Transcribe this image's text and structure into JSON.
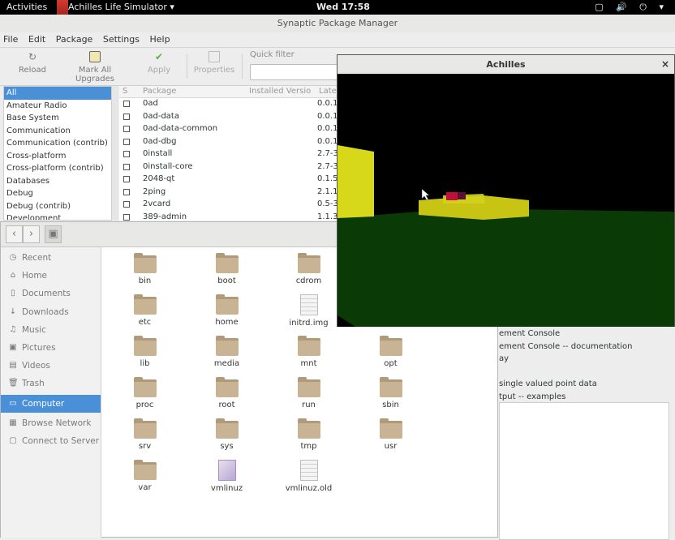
{
  "topbar": {
    "activities": "Activities",
    "app_menu": "Achilles Life Simulator ▾",
    "clock": "Wed 17:58",
    "tray": "▢ 🔊 ⏻ ▾"
  },
  "synaptic": {
    "title": "Synaptic Package Manager",
    "menu": [
      "File",
      "Edit",
      "Package",
      "Settings",
      "Help"
    ],
    "toolbar": {
      "reload": "Reload",
      "mark_all": "Mark All Upgrades",
      "apply": "Apply",
      "properties": "Properties",
      "quick_filter": "Quick filter"
    },
    "categories": [
      "All",
      "Amateur Radio",
      "Base System",
      "Communication",
      "Communication (contrib)",
      "Cross-platform",
      "Cross-platform (contrib)",
      "Databases",
      "Debug",
      "Debug (contrib)",
      "Development"
    ],
    "columns": {
      "s": "S",
      "package": "Package",
      "installed": "Installed Versio",
      "latest": "Late"
    },
    "packages": [
      {
        "name": "0ad",
        "ver": "0.0.1"
      },
      {
        "name": "0ad-data",
        "ver": "0.0.1"
      },
      {
        "name": "0ad-data-common",
        "ver": "0.0.1"
      },
      {
        "name": "0ad-dbg",
        "ver": "0.0.1"
      },
      {
        "name": "0install",
        "ver": "2.7-3"
      },
      {
        "name": "0install-core",
        "ver": "2.7-3"
      },
      {
        "name": "2048-qt",
        "ver": "0.1.5"
      },
      {
        "name": "2ping",
        "ver": "2.1.1"
      },
      {
        "name": "2vcard",
        "ver": "0.5-3"
      },
      {
        "name": "389-admin",
        "ver": "1.1.3"
      }
    ],
    "desc_lines": [
      "ement Console",
      "ement Console -- documentation",
      "ay",
      "",
      "single valued point data",
      "tput -- examples"
    ]
  },
  "files": {
    "sidebar": [
      {
        "icon": "◷",
        "icon_name": "recent-icon",
        "label": "Recent"
      },
      {
        "icon": "⌂",
        "icon_name": "home-icon",
        "label": "Home"
      },
      {
        "icon": "▯",
        "icon_name": "documents-icon",
        "label": "Documents"
      },
      {
        "icon": "↓",
        "icon_name": "downloads-icon",
        "label": "Downloads"
      },
      {
        "icon": "♫",
        "icon_name": "music-icon",
        "label": "Music"
      },
      {
        "icon": "▣",
        "icon_name": "pictures-icon",
        "label": "Pictures"
      },
      {
        "icon": "▤",
        "icon_name": "videos-icon",
        "label": "Videos"
      },
      {
        "icon": "🗑",
        "icon_name": "trash-icon",
        "label": "Trash"
      },
      {
        "icon": "▭",
        "icon_name": "computer-icon",
        "label": "Computer"
      },
      {
        "icon": "▦",
        "icon_name": "network-icon",
        "label": "Browse Network"
      },
      {
        "icon": "▢",
        "icon_name": "server-icon",
        "label": "Connect to Server"
      }
    ],
    "items": [
      {
        "name": "bin",
        "kind": "folder"
      },
      {
        "name": "boot",
        "kind": "folder"
      },
      {
        "name": "cdrom",
        "kind": "folder"
      },
      {
        "name": "etc",
        "kind": "folder"
      },
      {
        "name": "home",
        "kind": "folder"
      },
      {
        "name": "initrd.img",
        "kind": "file"
      },
      {
        "name": "lib",
        "kind": "folder"
      },
      {
        "name": "media",
        "kind": "folder"
      },
      {
        "name": "mnt",
        "kind": "folder"
      },
      {
        "name": "opt",
        "kind": "folder"
      },
      {
        "name": "proc",
        "kind": "folder"
      },
      {
        "name": "root",
        "kind": "folder"
      },
      {
        "name": "run",
        "kind": "folder"
      },
      {
        "name": "sbin",
        "kind": "folder"
      },
      {
        "name": "srv",
        "kind": "folder"
      },
      {
        "name": "sys",
        "kind": "folder"
      },
      {
        "name": "tmp",
        "kind": "folder"
      },
      {
        "name": "usr",
        "kind": "folder"
      },
      {
        "name": "var",
        "kind": "folder"
      },
      {
        "name": "vmlinuz",
        "kind": "link"
      },
      {
        "name": "vmlinuz.old",
        "kind": "file"
      }
    ]
  },
  "achilles": {
    "title": "Achilles",
    "close": "×",
    "colors": {
      "sky": "#000000",
      "ground": "#0a3a05",
      "block": "#d8d81a",
      "agent": "#c0103a"
    }
  }
}
